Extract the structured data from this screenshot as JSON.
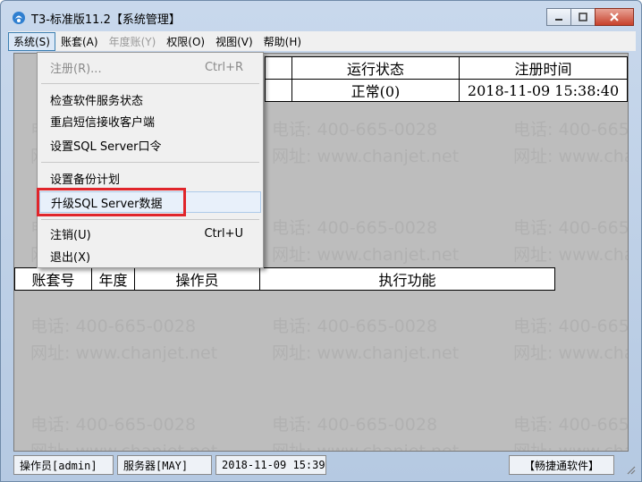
{
  "window": {
    "title": "T3-标准版11.2【系统管理】"
  },
  "menubar": [
    {
      "label": "系统(S)",
      "state": "active"
    },
    {
      "label": "账套(A)",
      "state": "normal"
    },
    {
      "label": "年度账(Y)",
      "state": "disabled"
    },
    {
      "label": "权限(O)",
      "state": "normal"
    },
    {
      "label": "视图(V)",
      "state": "normal"
    },
    {
      "label": "帮助(H)",
      "state": "normal"
    }
  ],
  "dropdown": {
    "items": [
      {
        "label": "注册(R)...",
        "shortcut": "Ctrl+R",
        "disabled": true
      },
      {
        "label": "检查软件服务状态",
        "shortcut": ""
      },
      {
        "label": "重启短信接收客户端",
        "shortcut": ""
      },
      {
        "label": "设置SQL Server口令",
        "shortcut": ""
      },
      {
        "label": "设置备份计划",
        "shortcut": ""
      },
      {
        "label": "升级SQL Server数据",
        "shortcut": "",
        "hover": true
      },
      {
        "label": "注销(U)",
        "shortcut": "Ctrl+U"
      },
      {
        "label": "退出(X)",
        "shortcut": ""
      }
    ]
  },
  "top_table": {
    "headers": [
      "",
      "运行状态",
      "注册时间"
    ],
    "row": [
      "",
      "正常(0)",
      "2018-11-09 15:38:40"
    ]
  },
  "log_table": {
    "headers": [
      "账套号",
      "年度",
      "操作员",
      "执行功能"
    ]
  },
  "watermark": {
    "phone": "电话: 400-665-0028",
    "site": "网址: www.chanjet.net"
  },
  "statusbar": {
    "operator": "操作员[admin]",
    "server": "服务器[MAY]",
    "time": "2018-11-09 15:39",
    "brand": "【畅捷通软件】"
  },
  "colors": {
    "highlight": "#e0252b",
    "client_bg": "#bdbdbd",
    "close_btn": "#c7412b"
  }
}
